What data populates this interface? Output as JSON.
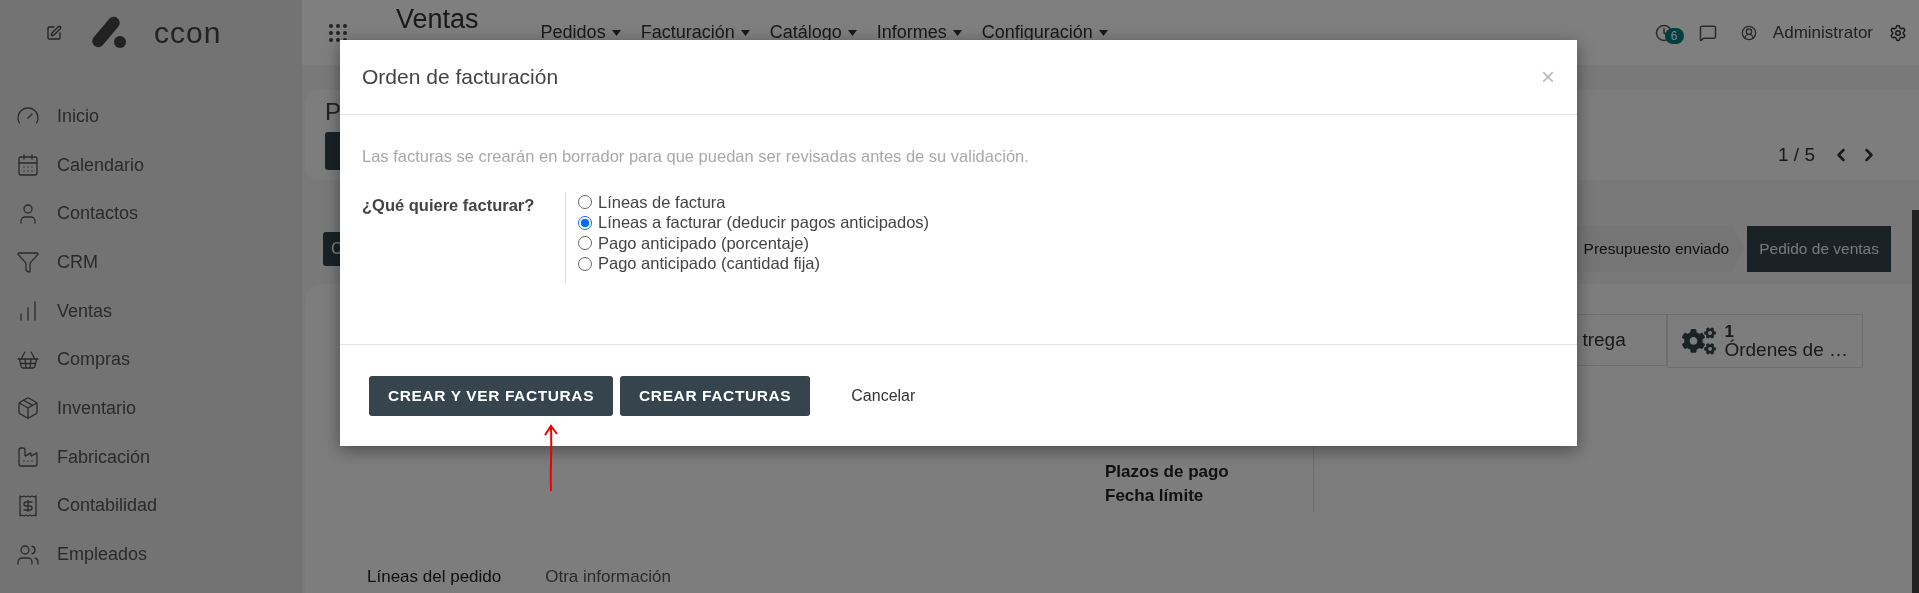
{
  "sidebar": {
    "logo": "ccon",
    "items": [
      {
        "label": "Inicio"
      },
      {
        "label": "Calendario"
      },
      {
        "label": "Contactos"
      },
      {
        "label": "CRM"
      },
      {
        "label": "Ventas"
      },
      {
        "label": "Compras"
      },
      {
        "label": "Inventario"
      },
      {
        "label": "Fabricación"
      },
      {
        "label": "Contabilidad"
      },
      {
        "label": "Empleados"
      }
    ]
  },
  "topbar": {
    "app_title": "Ventas",
    "menus": [
      "Pedidos",
      "Facturación",
      "Catálogo",
      "Informes",
      "Configuración"
    ],
    "activity_count": "6",
    "user": "Administrator"
  },
  "control_panel": {
    "breadcrumb": "P",
    "pager": "1 / 5"
  },
  "status_row": {
    "action_button": "C",
    "stages": [
      {
        "label": "Presupuesto enviado",
        "selected": false
      },
      {
        "label": "Pedido de ventas",
        "selected": true
      }
    ]
  },
  "form": {
    "smart_buttons": [
      {
        "kind": "text",
        "label": "trega"
      },
      {
        "kind": "stat",
        "value": "1",
        "label": "Órdenes de …"
      }
    ],
    "fields": [
      "Plazos de pago",
      "Fecha límite"
    ],
    "tabs": [
      {
        "label": "Líneas del pedido",
        "selected": true
      },
      {
        "label": "Otra información",
        "selected": false
      }
    ]
  },
  "dialog": {
    "title": "Orden de facturación",
    "close": "×",
    "note": "Las facturas se crearán en borrador para que puedan ser revisadas antes de su validación.",
    "question": "¿Qué quiere facturar?",
    "options": [
      {
        "label": "Líneas de factura",
        "selected": false
      },
      {
        "label": "Líneas a facturar (deducir pagos anticipados)",
        "selected": true
      },
      {
        "label": "Pago anticipado (porcentaje)",
        "selected": false
      },
      {
        "label": "Pago anticipado (cantidad fija)",
        "selected": false
      }
    ],
    "buttons": [
      {
        "label": "CREAR Y VER FACTURAS",
        "kind": "primary"
      },
      {
        "label": "CREAR FACTURAS",
        "kind": "primary"
      },
      {
        "label": "Cancelar",
        "kind": "link"
      }
    ]
  }
}
